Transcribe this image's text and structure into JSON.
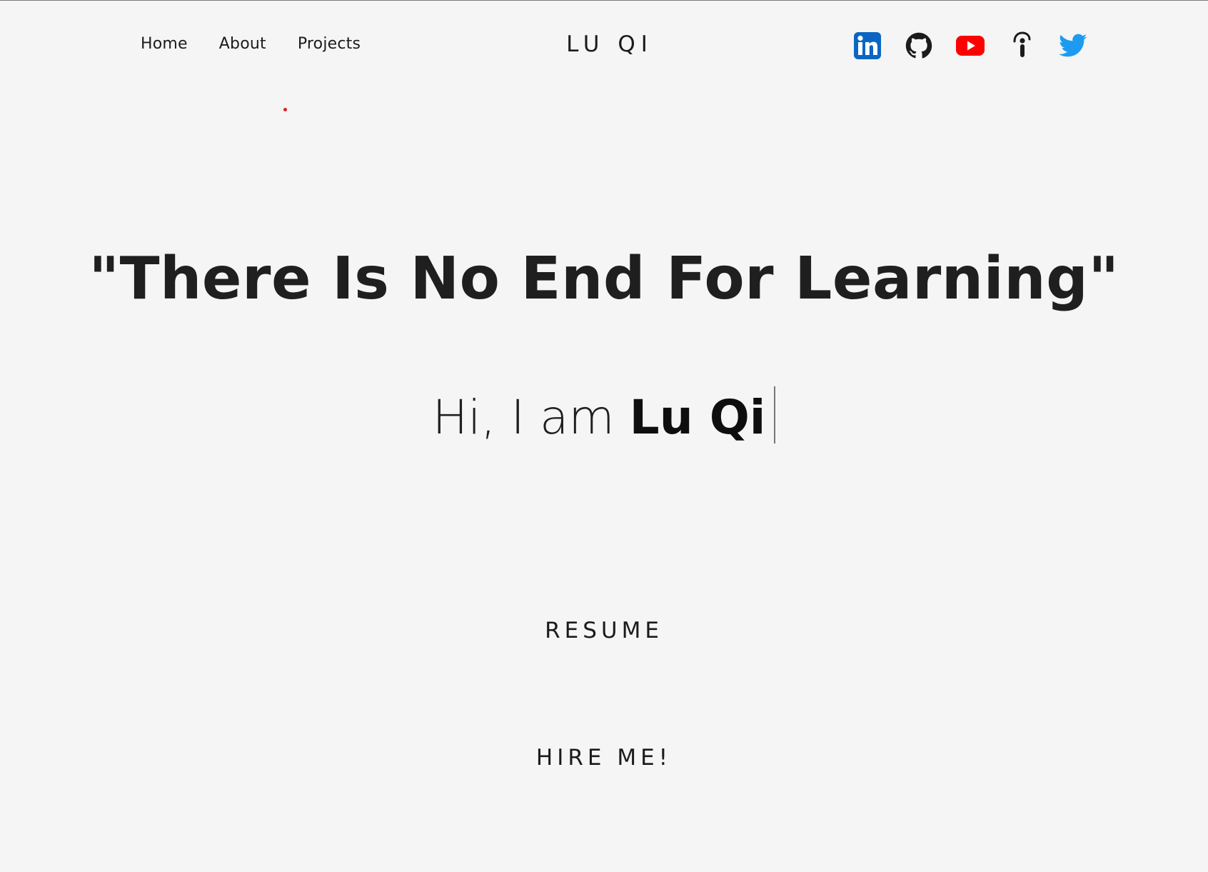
{
  "nav": {
    "items": [
      {
        "label": "Home"
      },
      {
        "label": "About"
      },
      {
        "label": "Projects"
      }
    ]
  },
  "brand": "LU QI",
  "social": {
    "icons": [
      "linkedin-icon",
      "github-icon",
      "youtube-icon",
      "instructables-icon",
      "twitter-icon"
    ],
    "colors": {
      "linkedin": "#0a66c2",
      "youtube": "#ff0000",
      "twitter": "#1d9bf0",
      "github": "#1b1b1b"
    }
  },
  "hero": {
    "quote": "\"There Is No End For Learning\"",
    "intro_prefix": "Hi, I am ",
    "intro_name": "Lu Qi"
  },
  "buttons": {
    "resume": "RESUME",
    "hire": "HIRE ME!"
  },
  "accent": "#e01b24",
  "background": "#f5f5f5"
}
